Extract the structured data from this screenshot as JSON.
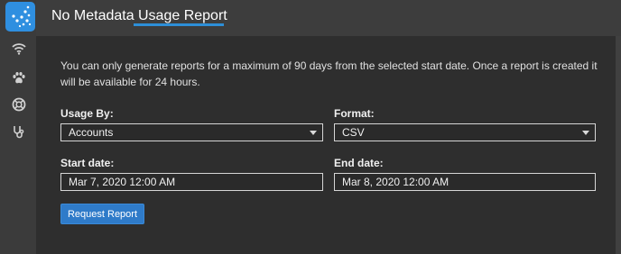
{
  "tabs": [
    {
      "label": "No Metadata",
      "active": false
    },
    {
      "label": "Usage Report",
      "active": true
    }
  ],
  "sidebar": {
    "icons": [
      "app-logo-icon",
      "wifi-icon",
      "paw-icon",
      "lifebuoy-icon",
      "stethoscope-icon"
    ]
  },
  "notice": "You can only generate reports for a maximum of 90 days from the selected start date. Once a report is created it will be available for 24 hours.",
  "form": {
    "usage_by": {
      "label": "Usage By:",
      "value": "Accounts"
    },
    "format": {
      "label": "Format:",
      "value": "CSV"
    },
    "start_date": {
      "label": "Start date:",
      "value": "Mar 7, 2020 12:00 AM"
    },
    "end_date": {
      "label": "End date:",
      "value": "Mar 8, 2020 12:00 AM"
    },
    "submit_label": "Request Report"
  },
  "colors": {
    "accent": "#2d8fd8",
    "button": "#2f7bc9",
    "panel": "#2e2e2e",
    "background": "#404040"
  }
}
